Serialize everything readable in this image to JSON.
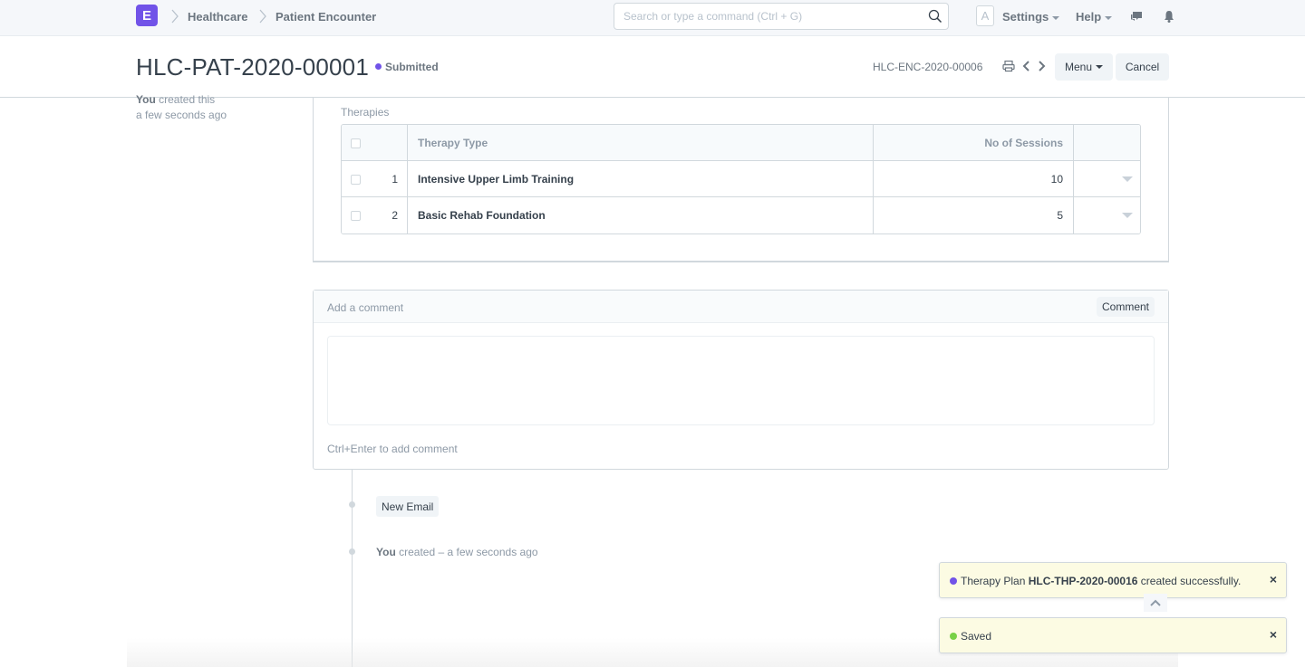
{
  "navbar": {
    "logo_letter": "E",
    "breadcrumbs": [
      "Healthcare",
      "Patient Encounter"
    ],
    "search_placeholder": "Search or type a command (Ctrl + G)",
    "avatar_letter": "A",
    "settings_label": "Settings",
    "help_label": "Help"
  },
  "page_head": {
    "title": "HLC-PAT-2020-00001",
    "status": "Submitted",
    "status_color": "#7153e8",
    "linked_doc": "HLC-ENC-2020-00006",
    "menu_label": "Menu",
    "cancel_label": "Cancel"
  },
  "sidebar": {
    "created_by": "You",
    "created_text": "created this",
    "created_time": "a few seconds ago"
  },
  "therapies": {
    "label": "Therapies",
    "columns": [
      "Therapy Type",
      "No of Sessions"
    ],
    "rows": [
      {
        "idx": "1",
        "therapy_type": "Intensive Upper Limb Training",
        "sessions": "10"
      },
      {
        "idx": "2",
        "therapy_type": "Basic Rehab Foundation",
        "sessions": "5"
      }
    ]
  },
  "comment": {
    "header_label": "Add a comment",
    "button_label": "Comment",
    "value": "",
    "hint": "Ctrl+Enter to add comment"
  },
  "timeline": {
    "new_email_label": "New Email",
    "entry_user": "You",
    "entry_text": "created – a few seconds ago"
  },
  "toasts": [
    {
      "prefix": "Therapy Plan",
      "bold": "HLC-THP-2020-00016",
      "suffix": "created successfully.",
      "dot_color": "#7153e8"
    },
    {
      "prefix": "Saved",
      "bold": "",
      "suffix": "",
      "dot_color": "#78d147"
    }
  ]
}
